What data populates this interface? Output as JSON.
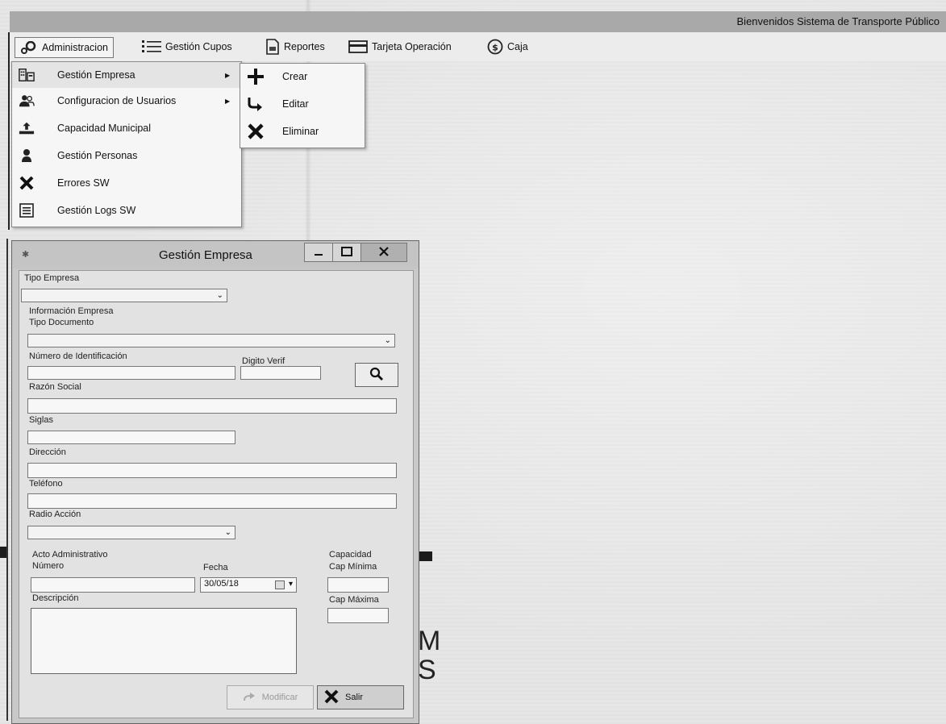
{
  "header": {
    "welcome": "Bienvenidos Sistema de Transporte Público"
  },
  "menubar": {
    "items": [
      {
        "label": "Administracion",
        "icon": "gears-icon"
      },
      {
        "label": "Gestión Cupos",
        "icon": "list-icon"
      },
      {
        "label": "Reportes",
        "icon": "report-icon"
      },
      {
        "label": "Tarjeta Operación",
        "icon": "card-icon"
      },
      {
        "label": "Caja",
        "icon": "dollar-circle-icon"
      }
    ]
  },
  "admin_menu": {
    "items": [
      {
        "label": "Gestión Empresa",
        "icon": "building-icon",
        "submenu": true
      },
      {
        "label": "Configuracion de Usuarios",
        "icon": "users-icon",
        "submenu": true
      },
      {
        "label": "Capacidad Municipal",
        "icon": "upload-icon",
        "submenu": false
      },
      {
        "label": "Gestión Personas",
        "icon": "person-icon",
        "submenu": false
      },
      {
        "label": "Errores SW",
        "icon": "x-icon",
        "submenu": false
      },
      {
        "label": "Gestión Logs SW",
        "icon": "log-icon",
        "submenu": false
      }
    ]
  },
  "empresa_submenu": {
    "items": [
      {
        "label": "Crear",
        "icon": "plus-icon"
      },
      {
        "label": "Editar",
        "icon": "redo-arrow-icon"
      },
      {
        "label": "Eliminar",
        "icon": "x-icon"
      }
    ]
  },
  "dialog": {
    "title": "Gestión Empresa",
    "tipo_empresa": {
      "label": "Tipo Empresa",
      "value": ""
    },
    "info_section": "Información Empresa",
    "tipo_documento": {
      "label": "Tipo Documento",
      "value": ""
    },
    "numero_identificacion": {
      "label": "Número de Identificación",
      "value": ""
    },
    "digito_verif": {
      "label": "Digito Verif",
      "value": ""
    },
    "razon_social": {
      "label": "Razón Social",
      "value": ""
    },
    "siglas": {
      "label": "Siglas",
      "value": ""
    },
    "direccion": {
      "label": "Dirección",
      "value": ""
    },
    "telefono": {
      "label": "Teléfono",
      "value": ""
    },
    "radio_accion": {
      "label": "Radio Acción",
      "value": ""
    },
    "acto_section": "Acto Administrativo",
    "numero": {
      "label": "Número",
      "value": ""
    },
    "fecha": {
      "label": "Fecha",
      "value": "30/05/18"
    },
    "capacidad_section": "Capacidad",
    "cap_minima": {
      "label": "Cap Mínima",
      "value": ""
    },
    "cap_maxima": {
      "label": "Cap Máxima",
      "value": ""
    },
    "descripcion": {
      "label": "Descripción",
      "value": ""
    },
    "modificar_label": "Modificar",
    "salir_label": "Salir"
  },
  "background_text": {
    "letters": [
      "M",
      "S"
    ]
  }
}
